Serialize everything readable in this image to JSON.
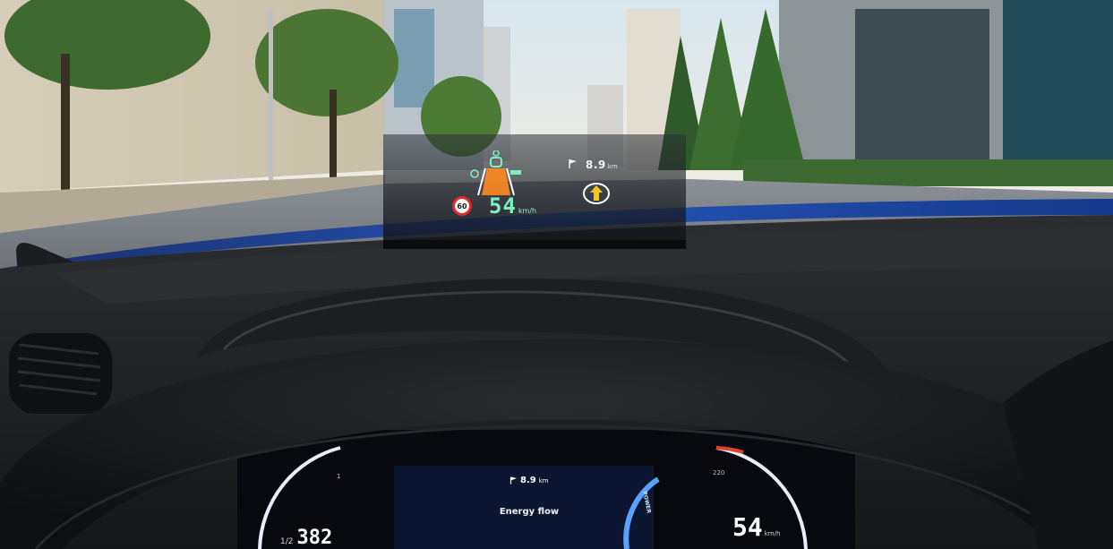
{
  "hud": {
    "distance_value": "8.9",
    "distance_unit": "km",
    "speed_value": "54",
    "speed_unit": "km/h",
    "speed_limit": "60",
    "icons": [
      "flag-icon",
      "turn-arrow-icon",
      "lane-assist-icon"
    ]
  },
  "cluster": {
    "distance_value": "8.9",
    "distance_unit": "km",
    "title": "Energy flow",
    "power_label": "POWER",
    "speed_value": "54",
    "speed_unit": "km/h",
    "speed_scale_label": "220",
    "range_prefix": "1/2",
    "range_value": "382",
    "fuel_mark": "1"
  },
  "colors": {
    "hud_green": "#7ef0c0",
    "hood_blue": "#1d3f8f",
    "limit_red": "#e02828",
    "cluster_accent": "#5aa2ff"
  }
}
